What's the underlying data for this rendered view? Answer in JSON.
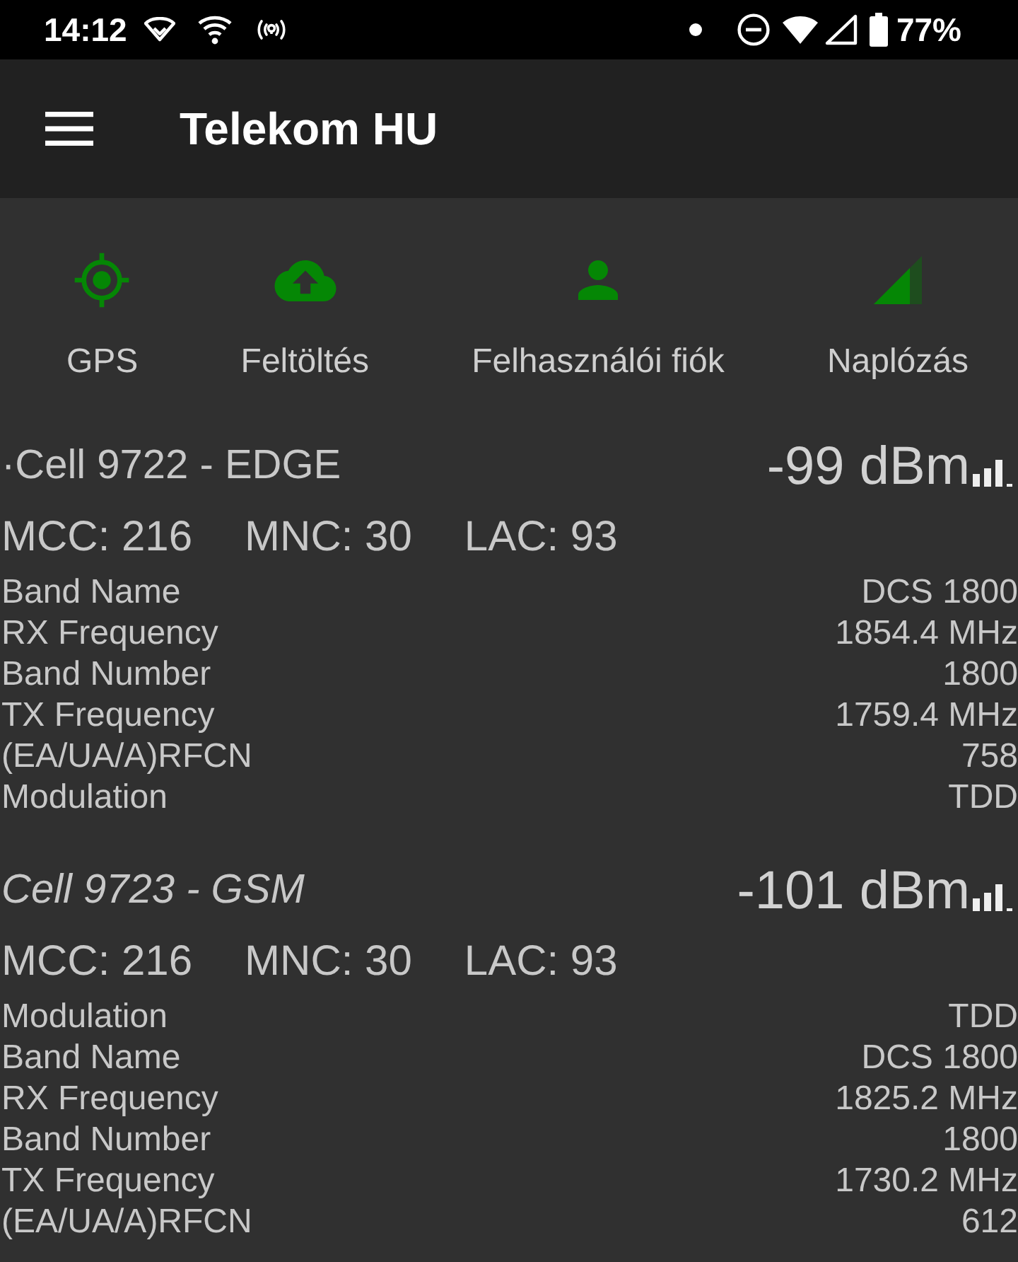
{
  "status_bar": {
    "time": "14:12",
    "battery": "77%"
  },
  "app_bar": {
    "title": "Telekom HU"
  },
  "actions": [
    {
      "kind": "gps",
      "label": "GPS"
    },
    {
      "kind": "upload",
      "label": "Feltöltés"
    },
    {
      "kind": "account",
      "label": "Felhasználói fiók"
    },
    {
      "kind": "logging",
      "label": "Naplózás"
    }
  ],
  "cells": [
    {
      "title": "·Cell 9722 - EDGE",
      "serving": true,
      "signal": "-99 dBm",
      "codes": [
        "MCC: 216",
        "MNC: 30",
        "LAC: 93"
      ],
      "fields": [
        {
          "label": "Band Name",
          "value": "DCS 1800"
        },
        {
          "label": "RX Frequency",
          "value": "1854.4 MHz"
        },
        {
          "label": "Band Number",
          "value": "1800"
        },
        {
          "label": "TX Frequency",
          "value": "1759.4 MHz"
        },
        {
          "label": "(EA/UA/A)RFCN",
          "value": "758"
        },
        {
          "label": "Modulation",
          "value": "TDD"
        }
      ]
    },
    {
      "title": "Cell 9723 - GSM",
      "serving": false,
      "signal": "-101 dBm",
      "codes": [
        "MCC: 216",
        "MNC: 30",
        "LAC: 93"
      ],
      "fields": [
        {
          "label": "Modulation",
          "value": "TDD"
        },
        {
          "label": "Band Name",
          "value": "DCS 1800"
        },
        {
          "label": "RX Frequency",
          "value": "1825.2 MHz"
        },
        {
          "label": "Band Number",
          "value": "1800"
        },
        {
          "label": "TX Frequency",
          "value": "1730.2 MHz"
        },
        {
          "label": "(EA/UA/A)RFCN",
          "value": "612"
        }
      ]
    }
  ]
}
